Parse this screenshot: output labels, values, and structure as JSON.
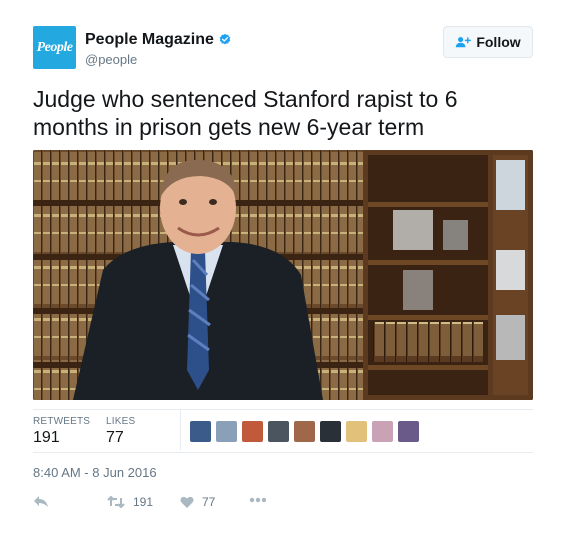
{
  "account": {
    "avatar_text": "People",
    "display_name": "People Magazine",
    "handle": "@people",
    "verified": true,
    "avatar_color": "#23a8e0"
  },
  "follow_button": {
    "label": "Follow",
    "icon": "add-user-icon"
  },
  "tweet": {
    "text": "Judge who sentenced Stanford rapist to 6 months in prison gets new 6-year term",
    "photo_icon": "judge-portrait-photo"
  },
  "stats": {
    "retweets_label": "RETWEETS",
    "retweets_value": "191",
    "likes_label": "LIKES",
    "likes_value": "77",
    "liker_avatar_count": 9
  },
  "timestamp": "8:40 AM - 8 Jun 2016",
  "actions": {
    "reply_icon": "reply-icon",
    "retweet_icon": "retweet-icon",
    "retweet_count": "191",
    "like_icon": "heart-icon",
    "like_count": "77",
    "more_icon": "more-dots-icon"
  },
  "colors": {
    "accent": "#1da1f2",
    "muted": "#657786",
    "text": "#14171a",
    "icon_gray": "#aab8c2"
  }
}
